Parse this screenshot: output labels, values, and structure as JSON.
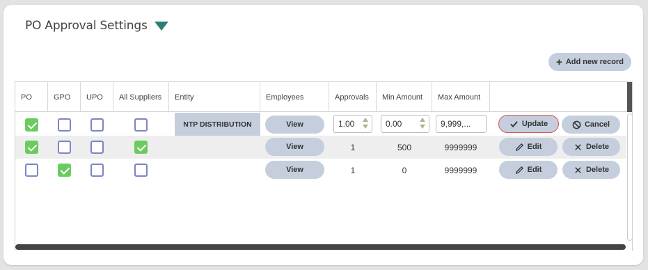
{
  "page": {
    "title": "PO Approval Settings",
    "add_button": "Add new record"
  },
  "columns": [
    "PO",
    "GPO",
    "UPO",
    "All Suppliers",
    "Entity",
    "Employees",
    "Approvals",
    "Min Amount",
    "Max Amount"
  ],
  "edit_row": {
    "po": true,
    "gpo": false,
    "upo": false,
    "all_suppliers": false,
    "entity": "NTP DISTRIBUTION",
    "employees_label": "View",
    "approvals": "1.00",
    "min_amount": "0.00",
    "max_amount": "9,999,...",
    "update_label": "Update",
    "cancel_label": "Cancel"
  },
  "rows": [
    {
      "po": true,
      "gpo": false,
      "upo": false,
      "all_suppliers": true,
      "entity": "",
      "employees_label": "View",
      "approvals": "1",
      "min_amount": "500",
      "max_amount": "9999999",
      "edit_label": "Edit",
      "delete_label": "Delete"
    },
    {
      "po": false,
      "gpo": true,
      "upo": false,
      "all_suppliers": false,
      "entity": "",
      "employees_label": "View",
      "approvals": "1",
      "min_amount": "0",
      "max_amount": "9999999",
      "edit_label": "Edit",
      "delete_label": "Delete"
    }
  ],
  "colors": {
    "accent": "#2e7d72",
    "button": "#c5cedd",
    "checkbox_on": "#6ccb5f",
    "checkbox_border": "#7d84c5",
    "alert": "#d9534f"
  }
}
